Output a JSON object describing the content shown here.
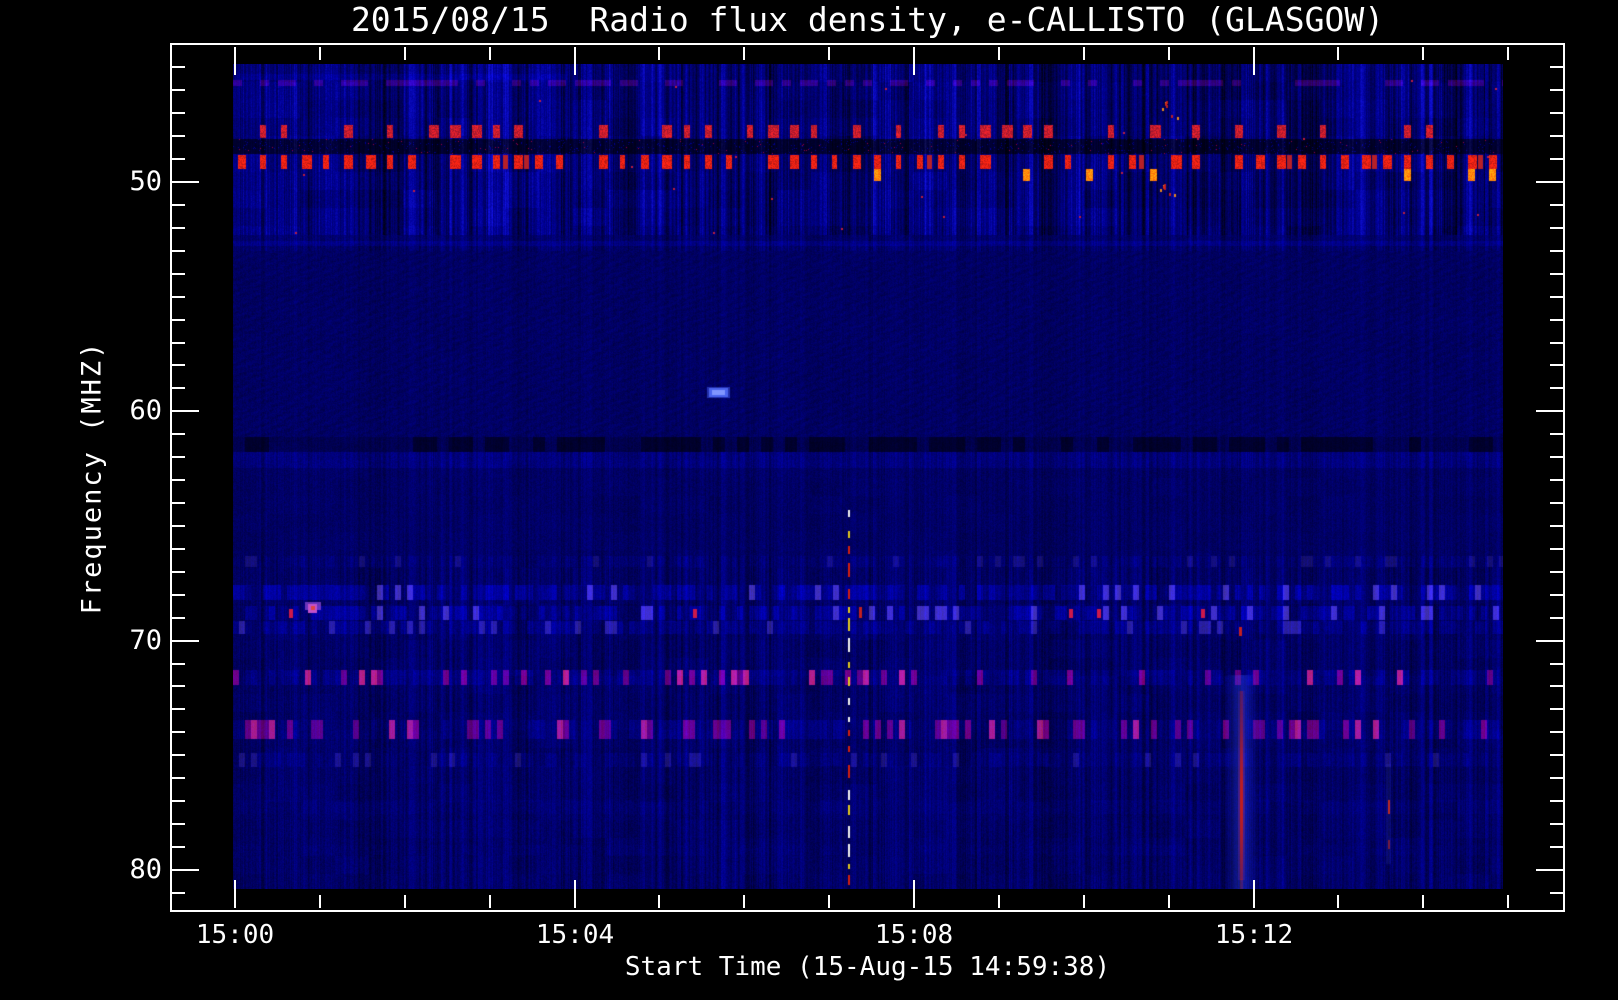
{
  "title": "2015/08/15  Radio flux density, e-CALLISTO (GLASGOW)",
  "chart_data": {
    "type": "heatmap",
    "subtype": "radio-spectrogram",
    "title": "2015/08/15  Radio flux density, e-CALLISTO (GLASGOW)",
    "xlabel": "Start Time (15-Aug-15 14:59:38)",
    "ylabel": "Frequency (MHZ)",
    "legend": "none",
    "grid": false,
    "x_axis": {
      "start_time": "14:59:38",
      "major_ticks": [
        {
          "label": "15:00",
          "minute": 0
        },
        {
          "label": "15:04",
          "minute": 4
        },
        {
          "label": "15:08",
          "minute": 8
        },
        {
          "label": "15:12",
          "minute": 12
        }
      ],
      "minor_tick_minutes": [
        1,
        2,
        3,
        5,
        6,
        7,
        9,
        10,
        11,
        13,
        14,
        15
      ],
      "range_minutes": [
        -0.74,
        15.64
      ]
    },
    "y_axis": {
      "unit": "MHz",
      "major_ticks": [
        50,
        60,
        70,
        80
      ],
      "minor_range": [
        45,
        81
      ],
      "range": [
        44.0,
        81.8
      ],
      "inverted": true
    },
    "data_extent": {
      "time_minutes": [
        0,
        14.94
      ],
      "freq_mhz": [
        44.85,
        80.83
      ]
    },
    "palette": {
      "background": "#000000",
      "base_blue": "#000096",
      "stripe_bright": "#2e2ee0",
      "rfi_red": "#d42114",
      "rfi_orange": "#ff910a",
      "rfi_magenta": "#b44cc8",
      "burst_red": "#d41e10",
      "dash_yellow": "#e3c81e",
      "axis": "#ffffff"
    },
    "regions": [
      {
        "name": "top-striped-band",
        "freq": [
          44.8,
          52.31
        ],
        "stripe": 0.95,
        "lift": 6
      },
      {
        "name": "transition",
        "freq": [
          52.31,
          52.97
        ],
        "stripe": 0.5,
        "lift": 3
      },
      {
        "name": "quiet-mid",
        "freq": [
          52.97,
          61.08
        ],
        "stripe": 0.18,
        "moire": true
      },
      {
        "name": "below-dark-band",
        "freq": [
          61.08,
          62.47
        ],
        "stripe": 0.3
      },
      {
        "name": "lower-mid",
        "freq": [
          62.47,
          66.3
        ],
        "stripe": 0.33
      },
      {
        "name": "lower-striped",
        "freq": [
          66.3,
          80.85
        ],
        "stripe": 0.55
      }
    ],
    "rows": [
      {
        "kind": "smear",
        "freq": [
          45.25,
          45.55
        ],
        "time_min": [
          0,
          3.9
        ]
      },
      {
        "kind": "violet-dash",
        "freq": [
          45.55,
          45.81
        ]
      },
      {
        "kind": "red-dash",
        "freq": [
          47.51,
          48.04
        ],
        "skip": 0.34,
        "color": [
          195,
          28,
          45
        ],
        "double": false
      },
      {
        "kind": "dark-row",
        "freq": [
          48.12,
          48.74
        ]
      },
      {
        "kind": "red-dash",
        "freq": [
          48.78,
          49.39
        ],
        "skip": 0.1,
        "color": [
          228,
          32,
          20
        ],
        "double": true
      },
      {
        "kind": "orange-blob",
        "freq": [
          49.39,
          49.95
        ],
        "prob": 0.22,
        "color": [
          255,
          145,
          10
        ]
      },
      {
        "kind": "light-line",
        "freq": [
          52.57,
          52.79
        ]
      },
      {
        "kind": "dark-dash",
        "freq": [
          61.08,
          61.77
        ]
      },
      {
        "kind": "bright-strip",
        "freq": [
          61.77,
          62.47
        ]
      },
      {
        "kind": "blue-dash",
        "freq": [
          66.31,
          66.75
        ],
        "strength": 0.3
      },
      {
        "kind": "blue-dash",
        "freq": [
          67.57,
          68.19
        ],
        "strength": 1.0
      },
      {
        "kind": "blue-dash",
        "freq": [
          68.49,
          69.1
        ],
        "strength": 1.0,
        "red_dots": true
      },
      {
        "kind": "blue-dash",
        "freq": [
          69.14,
          69.67
        ],
        "strength": 0.65
      },
      {
        "kind": "magenta-dash",
        "freq": [
          71.24,
          71.93
        ],
        "strength": 1.0
      },
      {
        "kind": "magenta-dash",
        "freq": [
          73.46,
          74.29
        ],
        "strength": 0.9
      },
      {
        "kind": "blue-dash",
        "freq": [
          74.86,
          75.51
        ],
        "strength": 0.4
      },
      {
        "kind": "faint-band",
        "freq": [
          76.91,
          77.52
        ],
        "strength": 0.25
      },
      {
        "kind": "faint-band",
        "freq": [
          78.9,
          79.35
        ],
        "strength": 0.16
      }
    ],
    "features": [
      {
        "kind": "blob",
        "name": "bright-blue-blob",
        "time_min": [
          5.58,
          5.81
        ],
        "freq_mhz": [
          58.98,
          59.38
        ],
        "colors": [
          "#4a63ee",
          "#8095ff"
        ]
      },
      {
        "kind": "blob-magenta",
        "name": "magenta-spot",
        "time_min": [
          0.83,
          1.01
        ],
        "freq_mhz": [
          68.32,
          68.8
        ]
      },
      {
        "kind": "dashed-vline",
        "name": "dashed-interference-line",
        "time_min": 7.22,
        "freq_mhz": [
          64.3,
          80.75
        ],
        "colors": [
          "#d21f10",
          "#e3c81e",
          "#f0f0f0"
        ]
      },
      {
        "kind": "red-tick",
        "name": "red-dash-mark",
        "time_min": 7.35,
        "freq_mhz": [
          68.53,
          69.0
        ]
      },
      {
        "kind": "burst-streak",
        "name": "strong-vertical-burst",
        "time_min": 11.85,
        "halo_time_min": [
          11.66,
          12.02
        ],
        "freq_mhz": [
          71.5,
          80.85
        ],
        "core_freq_mhz": [
          72.2,
          80.4
        ],
        "peak_freq_mhz": [
          75.6,
          78.3
        ]
      },
      {
        "kind": "red-tick",
        "name": "burst-top-dash",
        "time_min": 11.83,
        "freq_mhz": [
          69.4,
          69.8
        ]
      },
      {
        "kind": "faint-vline",
        "name": "faint-red-line",
        "time_min": 13.59,
        "dash_freq_mhz": [
          [
            76.95,
            77.56
          ],
          [
            78.69,
            79.08
          ]
        ]
      },
      {
        "kind": "speck-cluster",
        "name": "orange-specks-upper",
        "time_min": [
          10.8,
          11.15
        ],
        "freq_mhz": [
          46.4,
          47.3
        ]
      },
      {
        "kind": "speck-cluster",
        "name": "orange-specks-lower",
        "time_min": [
          10.8,
          11.1
        ],
        "freq_mhz": [
          50.05,
          50.6
        ]
      }
    ]
  }
}
